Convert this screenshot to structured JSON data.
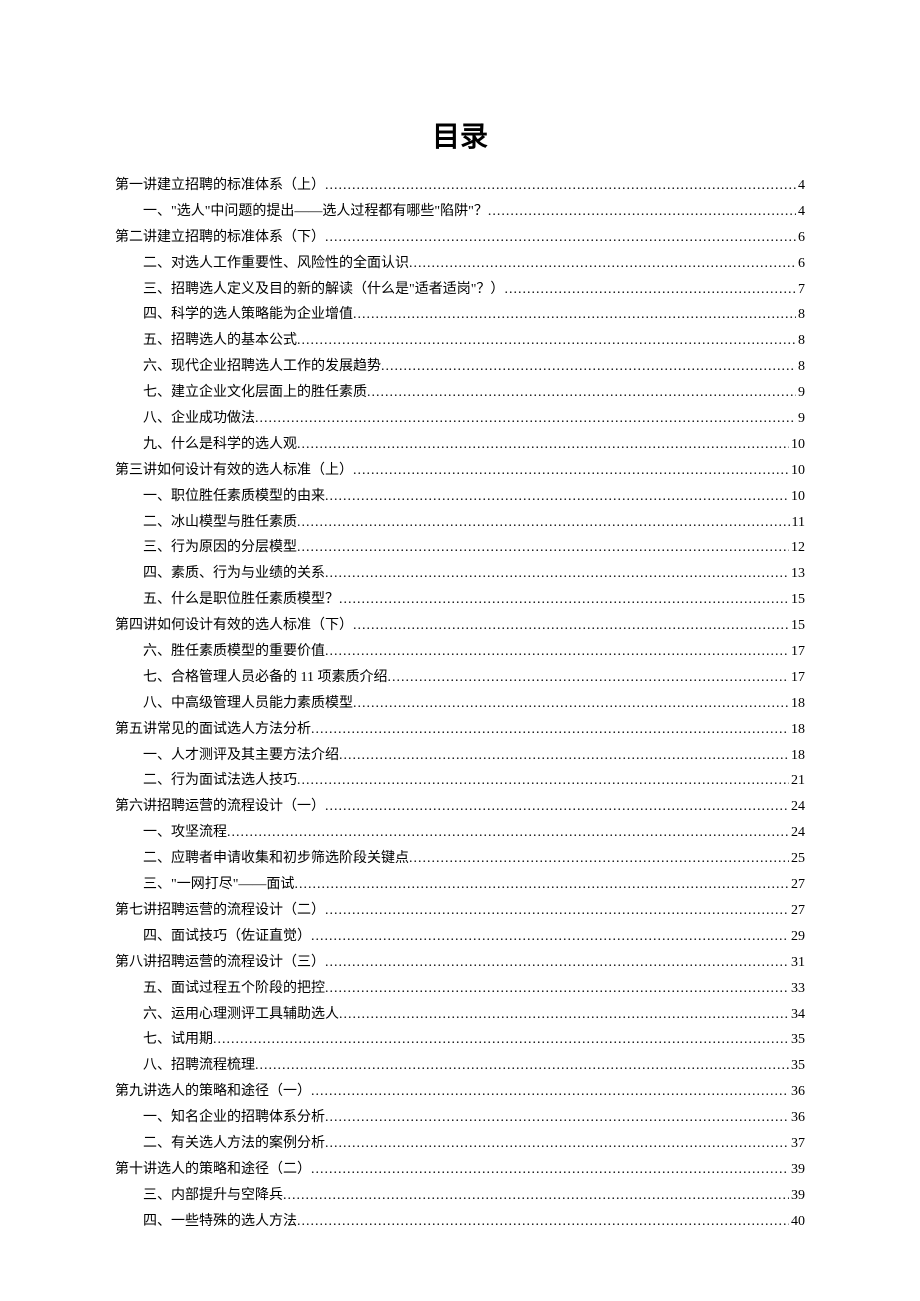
{
  "title": "目录",
  "entries": [
    {
      "level": 1,
      "label": "第一讲建立招聘的标准体系（上）",
      "page": "4"
    },
    {
      "level": 2,
      "label": "一、\"选人\"中问题的提出——选人过程都有哪些\"陷阱\"？",
      "page": "4"
    },
    {
      "level": 1,
      "label": "第二讲建立招聘的标准体系（下）",
      "page": "6"
    },
    {
      "level": 2,
      "label": "二、对选人工作重要性、风险性的全面认识",
      "page": "6"
    },
    {
      "level": 2,
      "label": "三、招聘选人定义及目的新的解读（什么是\"适者适岗\"？）",
      "page": "7"
    },
    {
      "level": 2,
      "label": "四、科学的选人策略能为企业增值",
      "page": "8"
    },
    {
      "level": 2,
      "label": "五、招聘选人的基本公式",
      "page": "8"
    },
    {
      "level": 2,
      "label": "六、现代企业招聘选人工作的发展趋势",
      "page": "8"
    },
    {
      "level": 2,
      "label": "七、建立企业文化层面上的胜任素质",
      "page": "9"
    },
    {
      "level": 2,
      "label": "八、企业成功做法",
      "page": "9"
    },
    {
      "level": 2,
      "label": "九、什么是科学的选人观",
      "page": "10"
    },
    {
      "level": 1,
      "label": "第三讲如何设计有效的选人标准（上）",
      "page": "10"
    },
    {
      "level": 2,
      "label": "一、职位胜任素质模型的由来",
      "page": "10"
    },
    {
      "level": 2,
      "label": "二、冰山模型与胜任素质",
      "page": "11"
    },
    {
      "level": 2,
      "label": "三、行为原因的分层模型",
      "page": "12"
    },
    {
      "level": 2,
      "label": "四、素质、行为与业绩的关系",
      "page": "13"
    },
    {
      "level": 2,
      "label": "五、什么是职位胜任素质模型？",
      "page": "15"
    },
    {
      "level": 1,
      "label": "第四讲如何设计有效的选人标准（下）",
      "page": "15"
    },
    {
      "level": 2,
      "label": "六、胜任素质模型的重要价值",
      "page": "17"
    },
    {
      "level": 2,
      "label": "七、合格管理人员必备的 11 项素质介绍",
      "page": "17"
    },
    {
      "level": 2,
      "label": "八、中高级管理人员能力素质模型",
      "page": "18"
    },
    {
      "level": 1,
      "label": "第五讲常见的面试选人方法分析",
      "page": "18"
    },
    {
      "level": 2,
      "label": "一、人才测评及其主要方法介绍",
      "page": "18"
    },
    {
      "level": 2,
      "label": "二、行为面试法选人技巧",
      "page": "21"
    },
    {
      "level": 1,
      "label": "第六讲招聘运营的流程设计（一）",
      "page": "24"
    },
    {
      "level": 2,
      "label": "一、攻坚流程",
      "page": "24"
    },
    {
      "level": 2,
      "label": "二、应聘者申请收集和初步筛选阶段关键点",
      "page": "25"
    },
    {
      "level": 2,
      "label": "三、\"一网打尽\"——面试",
      "page": "27"
    },
    {
      "level": 1,
      "label": "第七讲招聘运营的流程设计（二）",
      "page": "27"
    },
    {
      "level": 2,
      "label": "四、面试技巧（佐证直觉）",
      "page": "29"
    },
    {
      "level": 1,
      "label": "第八讲招聘运营的流程设计（三）",
      "page": "31"
    },
    {
      "level": 2,
      "label": "五、面试过程五个阶段的把控",
      "page": "33"
    },
    {
      "level": 2,
      "label": "六、运用心理测评工具辅助选人",
      "page": "34"
    },
    {
      "level": 2,
      "label": "七、试用期",
      "page": "35"
    },
    {
      "level": 2,
      "label": "八、招聘流程梳理",
      "page": "35"
    },
    {
      "level": 1,
      "label": "第九讲选人的策略和途径（一）",
      "page": "36"
    },
    {
      "level": 2,
      "label": "一、知名企业的招聘体系分析",
      "page": "36"
    },
    {
      "level": 2,
      "label": "二、有关选人方法的案例分析",
      "page": "37"
    },
    {
      "level": 1,
      "label": "第十讲选人的策略和途径（二）",
      "page": "39"
    },
    {
      "level": 2,
      "label": "三、内部提升与空降兵",
      "page": "39"
    },
    {
      "level": 2,
      "label": "四、一些特殊的选人方法",
      "page": "40"
    }
  ]
}
